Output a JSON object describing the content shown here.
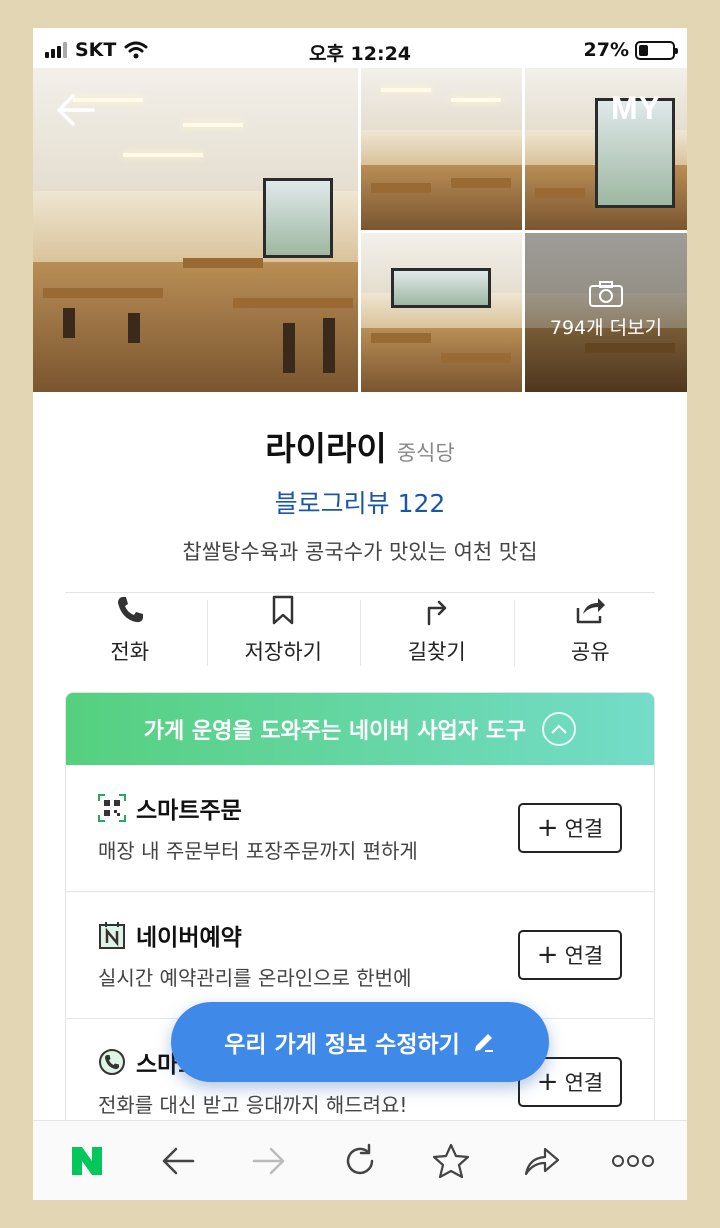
{
  "status_bar": {
    "carrier": "SKT",
    "time": "오후 12:24",
    "battery": "27%",
    "battery_level": 0.27
  },
  "gallery": {
    "top_right_label": "MY",
    "more_photos_label": "794개 더보기"
  },
  "place": {
    "name": "라이라이",
    "category": "중식당",
    "blog_reviews": "블로그리뷰 122",
    "description": "찹쌀탕수육과 콩국수가 맛있는 여천 맛집"
  },
  "actions": [
    {
      "label": "전화",
      "icon": "phone-icon"
    },
    {
      "label": "저장하기",
      "icon": "bookmark-icon"
    },
    {
      "label": "길찾기",
      "icon": "directions-icon"
    },
    {
      "label": "공유",
      "icon": "share-icon"
    }
  ],
  "tools": {
    "header": "가게 운영을 도와주는 네이버 사업자 도구",
    "items": [
      {
        "title": "스마트주문",
        "desc": "매장 내 주문부터 포장주문까지 편하게",
        "button": "연결",
        "icon": "qr-code-icon"
      },
      {
        "title": "네이버예약",
        "desc": "실시간 예약관리를 온라인으로 한번에",
        "button": "연결",
        "icon": "calendar-n-icon"
      },
      {
        "title": "스마트콜",
        "desc": "전화를 대신 받고 응대까지 해드려요!",
        "button": "연결",
        "icon": "phone-circle-icon"
      }
    ]
  },
  "fab": {
    "label": "우리 가게 정보 수정하기",
    "icon": "pencil-icon"
  },
  "bottom_bar": {
    "icons": [
      "naver-n-icon",
      "back-arrow-icon",
      "forward-arrow-icon",
      "refresh-icon",
      "star-icon",
      "share-arrow-icon",
      "more-icon"
    ],
    "brand_color": "#03c75a"
  },
  "colors": {
    "accent_blue": "#3f8ae8",
    "link_blue": "#1a56a8",
    "header_gradient_start": "#55d07e",
    "header_gradient_end": "#74dcc9"
  }
}
